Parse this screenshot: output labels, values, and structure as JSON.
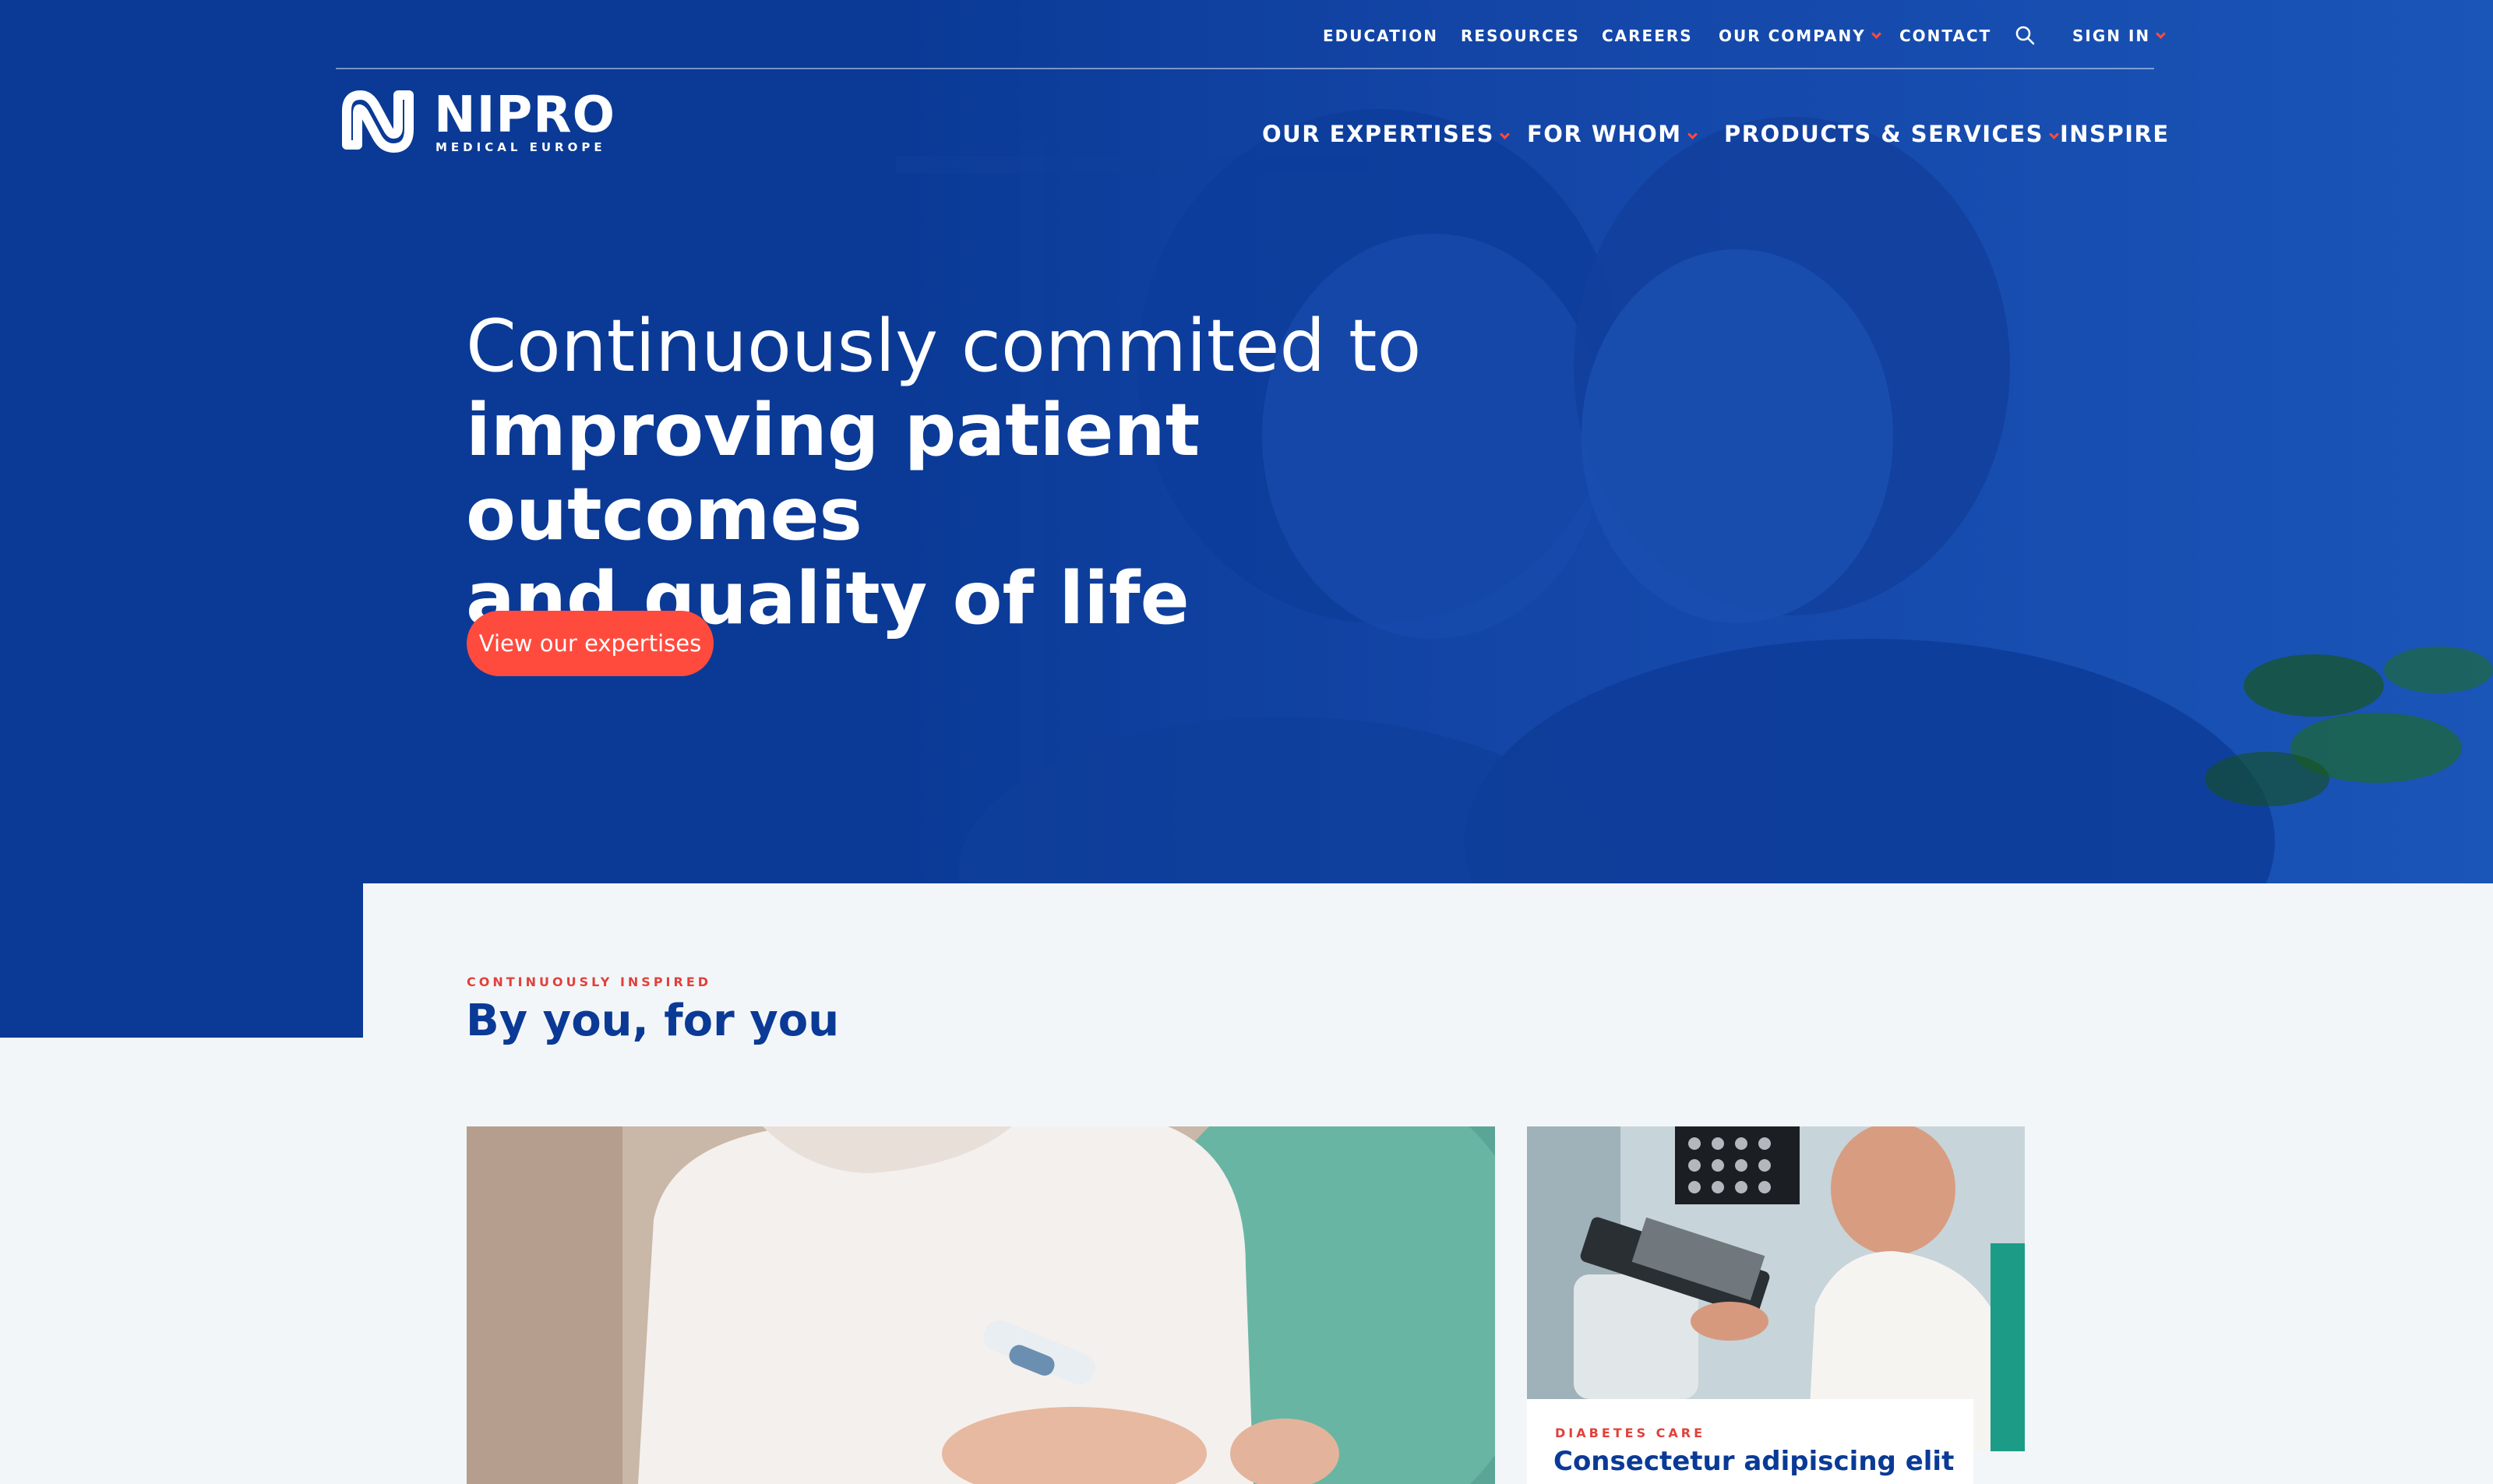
{
  "utility_nav": {
    "education": "EDUCATION",
    "resources": "RESOURCES",
    "careers": "CAREERS",
    "our_company": "OUR COMPANY",
    "contact": "CONTACT",
    "sign_in": "SIGN IN",
    "search_icon": "search-icon"
  },
  "logo": {
    "wordmark": "NIPRO",
    "subtitle": "MEDICAL EUROPE"
  },
  "main_nav": {
    "our_expertises": "OUR EXPERTISES",
    "for_whom": "FOR WHOM",
    "products_services": "PRODUCTS & SERVICES",
    "inspire": "INSPIRE"
  },
  "hero": {
    "title_line1": "Continuously commited to",
    "title_line2": "improving patient outcomes",
    "title_line3": "and quality of life",
    "cta_label": "View our expertises"
  },
  "inspired": {
    "eyebrow": "CONTINUOUSLY INSPIRED",
    "title": "By you, for you"
  },
  "cards": [
    {
      "tag": "",
      "title": ""
    },
    {
      "tag": "DIABETES CARE",
      "title": "Consectetur adipiscing elit"
    }
  ],
  "colors": {
    "brand_blue": "#0a3a96",
    "accent_red": "#ff4b3e",
    "page_background": "#f3f6f9"
  }
}
